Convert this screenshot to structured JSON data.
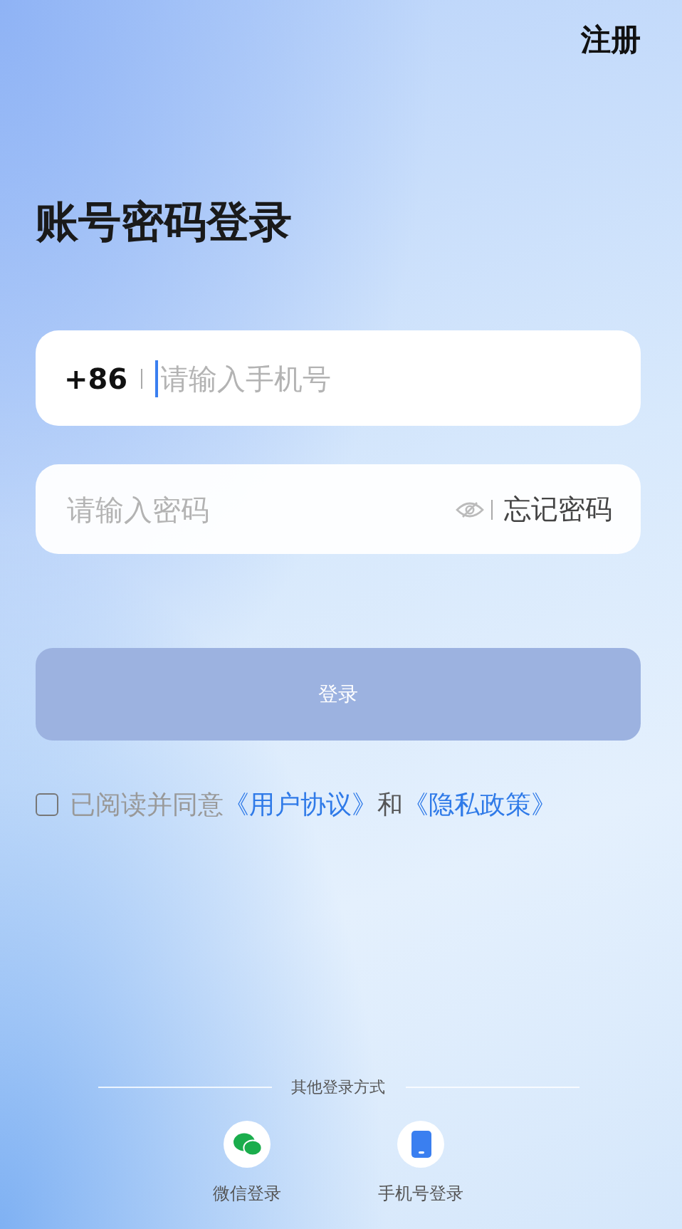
{
  "header": {
    "register": "注册"
  },
  "title": "账号密码登录",
  "phone_field": {
    "country_code": "+86",
    "placeholder": "请输入手机号"
  },
  "password_field": {
    "placeholder": "请输入密码",
    "forgot": "忘记密码"
  },
  "login_button": {
    "label": "登录",
    "disabled": true
  },
  "agreement": {
    "checked": false,
    "prefix": "已阅读并同意",
    "links": [
      "《用户协议》",
      "《隐私政策》"
    ],
    "joiner": "和"
  },
  "other_login": {
    "title": "其他登录方式",
    "methods": [
      {
        "kind": "wechat",
        "label": "微信登录"
      },
      {
        "kind": "phone",
        "label": "手机号登录"
      }
    ]
  }
}
